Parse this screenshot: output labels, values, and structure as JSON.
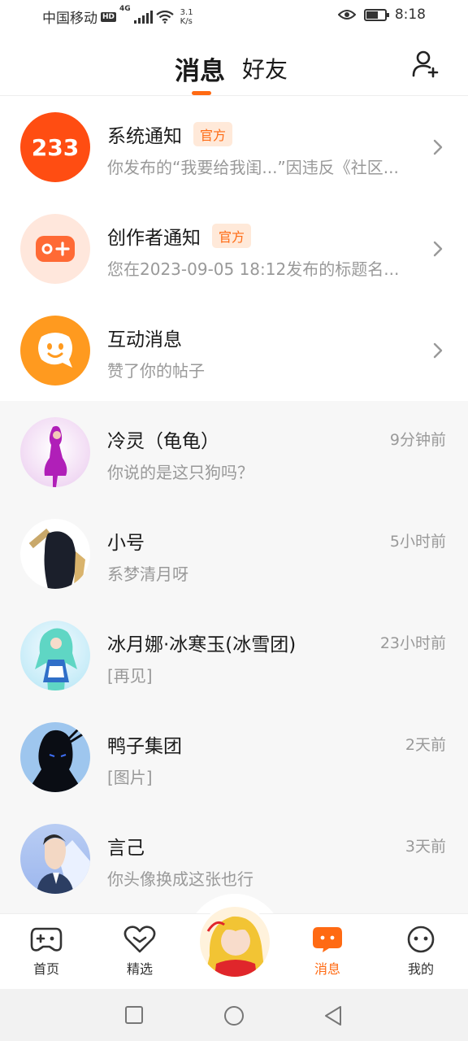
{
  "status_bar": {
    "carrier": "中国移动",
    "hd": "HD",
    "network": "4G",
    "speed_value": "3.1",
    "speed_unit": "K/s",
    "time": "8:18"
  },
  "header": {
    "tabs": [
      {
        "label": "消息",
        "active": true
      },
      {
        "label": "好友",
        "active": false
      }
    ],
    "accent_color": "#ff6a13"
  },
  "notices": [
    {
      "title": "系统通知",
      "badge": "官方",
      "subtitle": "你发布的“我要给我闺...”因违反《社区...",
      "icon": "233-logo-icon",
      "color": "#ff4d12"
    },
    {
      "title": "创作者通知",
      "badge": "官方",
      "subtitle": "您在2023-09-05 18:12发布的标题名...",
      "icon": "gamepad-plus-icon",
      "color": "#ffe7dc"
    },
    {
      "title": "互动消息",
      "badge": "",
      "subtitle": "赞了你的帖子",
      "icon": "smile-bubble-icon",
      "color": "#ff9a1f"
    }
  ],
  "chats": [
    {
      "name": "冷灵（龟龟）",
      "message": "你说的是这只狗吗？",
      "time": "9分钟前"
    },
    {
      "name": "小号",
      "message": "系梦清月呀",
      "time": "5小时前"
    },
    {
      "name": "冰月娜·冰寒玉(冰雪团)",
      "message": "[再见]",
      "time": "23小时前"
    },
    {
      "name": "鸭子集团",
      "message": "[图片]",
      "time": "2天前"
    },
    {
      "name": "言己",
      "message": "你头像换成这张也行",
      "time": "3天前"
    }
  ],
  "bottom_nav": [
    {
      "label": "首页",
      "icon": "gamepad-icon",
      "active": false
    },
    {
      "label": "精选",
      "icon": "heart-icon",
      "active": false
    },
    {
      "label": "消息",
      "icon": "chat-bubble-icon",
      "active": true
    },
    {
      "label": "我的",
      "icon": "face-icon",
      "active": false
    }
  ]
}
